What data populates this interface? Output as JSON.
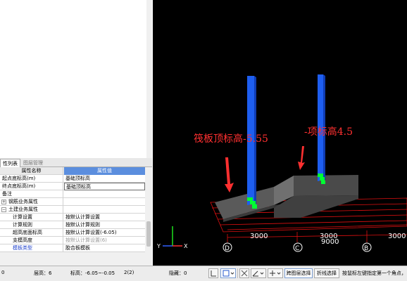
{
  "property_panel": {
    "tabs": [
      "性列表",
      "图层管理"
    ],
    "headers": {
      "name": "属性名称",
      "value": "属性值"
    },
    "rows": [
      {
        "name": "起点底标高(m)",
        "value": "基础顶标高"
      },
      {
        "name": "终点底标高(m)",
        "value": "基础顶标高"
      },
      {
        "name": "备注",
        "value": ""
      },
      {
        "name": "钢筋业务属性",
        "value": ""
      },
      {
        "name": "土建业务属性",
        "value": ""
      },
      {
        "name": "计算设置",
        "value": "按默认计算设置"
      },
      {
        "name": "计算规则",
        "value": "按默认计算规则"
      },
      {
        "name": "超高底面标高",
        "value": "按默认计算设置(-6.05)"
      },
      {
        "name": "支模高度",
        "value": "按默认计算设置(6)"
      },
      {
        "name": "模板类型",
        "value": "胶合板模板"
      }
    ],
    "expander_plus": "+",
    "expander_minus": "−"
  },
  "viewport": {
    "annotations": {
      "left": "筏板顶标高-5.55",
      "right": "-项标高4.5"
    },
    "dimensions": [
      "3000",
      "3000",
      "9000",
      "3000"
    ],
    "axes": [
      "D",
      "C",
      "B"
    ],
    "axis_labels": {
      "x": "X",
      "y": "Y"
    },
    "colors": {
      "background": "#000000",
      "slab": "#5c5c5c",
      "column": "#1e5ef0",
      "rebar": "#00ff33",
      "grid": "#e01010",
      "annotation": "#ff3030"
    }
  },
  "status_bar": {
    "floor": "层高：6",
    "elevation": "标高：-6.05~-0.05",
    "count": "2(2)",
    "hidden": "隐藏：0",
    "cross_layer_select": "跨图层选择",
    "polyline_select": "折线选择",
    "hint": "按鼠标左键指定第一个角点，"
  }
}
